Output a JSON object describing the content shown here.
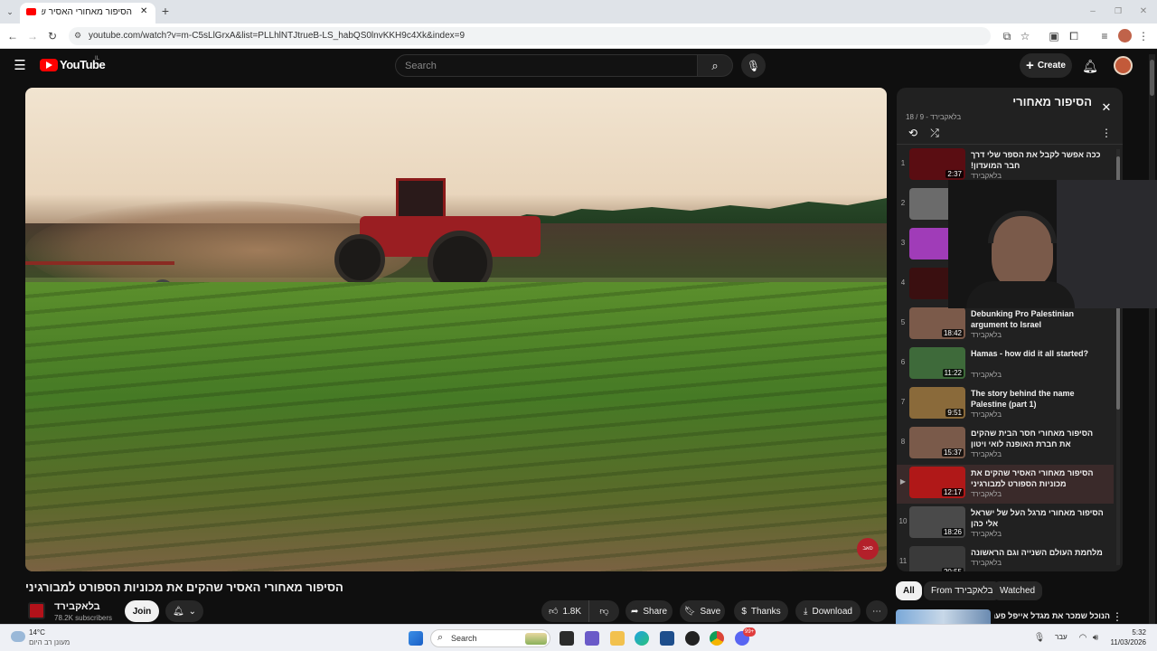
{
  "browser": {
    "tab_title": "הסיפור מאחורי האסיר שה...",
    "url": "youtube.com/watch?v=m-C5sLlGrxA&list=PLLhlNTJtrueB-LS_habQS0lnvKKH9c4Xk&index=9",
    "new_tab_glyph": "+",
    "close_glyph": "✕"
  },
  "youtube": {
    "logo_text": "YouTube",
    "region": "IL",
    "search_placeholder": "Search",
    "create_label": "Create"
  },
  "video": {
    "title": "הסיפור מאחורי האסיר שהקים את מכוניות הספורט למבורגיני",
    "watermark": "סאב"
  },
  "channel": {
    "name": "בלאקבירד",
    "subscribers": "78.2K subscribers",
    "join_label": "Join"
  },
  "actions": {
    "likes": "1.8K",
    "share": "Share",
    "save": "Save",
    "thanks": "Thanks",
    "download": "Download"
  },
  "playlist": {
    "title": "הסיפור מאחורי",
    "meta": "בלאקבירד - 9 / 18",
    "items": [
      {
        "index": "1",
        "title": "ככה אפשר לקבל את הספר שלי דרך חבר המועדון!",
        "channel": "בלאקבירד",
        "duration": "2:37",
        "color": "#5a0d12"
      },
      {
        "index": "2",
        "title": "",
        "channel": "",
        "duration": "",
        "color": "#6b6b6b"
      },
      {
        "index": "3",
        "title": "",
        "channel": "",
        "duration": "",
        "color": "#a03cb8"
      },
      {
        "index": "4",
        "title": "",
        "channel": "",
        "duration": "",
        "color": "#3a0f10"
      },
      {
        "index": "5",
        "title": "Debunking Pro Palestinian argument to Israel",
        "channel": "בלאקבירד",
        "duration": "18:42",
        "color": "#7b5a4a"
      },
      {
        "index": "6",
        "title": "Hamas - how did it all started?",
        "channel": "בלאקבירד",
        "duration": "11:22",
        "color": "#3e6a3a"
      },
      {
        "index": "7",
        "title": "The story behind the name Palestine (part 1)",
        "channel": "בלאקבירד",
        "duration": "9:51",
        "color": "#8a6a3a"
      },
      {
        "index": "8",
        "title": "הסיפור מאחורי חסר הבית שהקים את חברת האופנה לואי ויטון",
        "channel": "בלאקבירד",
        "duration": "15:37",
        "color": "#7a5a4a"
      },
      {
        "index": "▶",
        "title": "הסיפור מאחורי האסיר שהקים את מכוניות הספורט למבורגיני",
        "channel": "בלאקבירד",
        "duration": "12:17",
        "color": "#b01818"
      },
      {
        "index": "10",
        "title": "הסיפור מאחורי מרגל העל של ישראל אלי כהן",
        "channel": "בלאקבירד",
        "duration": "18:26",
        "color": "#4a4a4a"
      },
      {
        "index": "11",
        "title": "מלחמת העולם השנייה וגם הראשונה",
        "channel": "בלאקבירד",
        "duration": "20:55",
        "color": "#3a3a3a"
      }
    ]
  },
  "chips": {
    "all": "All",
    "from": "From בלאקבירד",
    "watched": "Watched"
  },
  "next_video": {
    "title": "הנוכל שמכר את מגדל אייפל פעמיים |"
  },
  "taskbar": {
    "weather_temp": "14°C",
    "weather_desc": "מעונן רב היום",
    "search_label": "Search",
    "lang": "עבר",
    "time": "5:32",
    "date": "11/03/2026",
    "badge": "99+"
  },
  "colors": {
    "yt_red": "#ff0000",
    "active_row": "#3a2a2a"
  }
}
